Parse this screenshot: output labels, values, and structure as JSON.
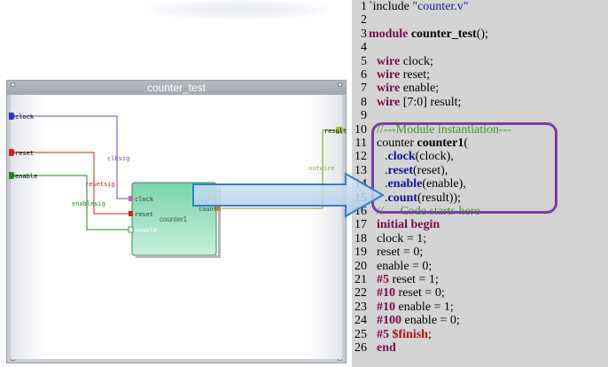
{
  "schematic": {
    "title": "counter_test",
    "ports": {
      "clock": "clock",
      "reset": "reset",
      "enable": "enable",
      "result": "result"
    },
    "wires": {
      "clksig": "clksig",
      "resetsig": "resetsig",
      "enablesig": "enablesig",
      "outwire": "outwire"
    },
    "instance": {
      "name": "counter1",
      "clock": "clock",
      "reset": "reset",
      "enable": "enable",
      "count": "count"
    }
  },
  "colors": {
    "highlight_box": "#7a3fa6",
    "arrow": "#2f7fd0",
    "clock_wire": "#7040c0",
    "reset_wire": "#d02020",
    "enable_wire": "#1a8a1a",
    "result_wire": "#a0c040"
  },
  "code": {
    "lines": [
      {
        "n": "1",
        "t": "`include \"counter.v\""
      },
      {
        "n": "2",
        "t": ""
      },
      {
        "n": "3",
        "t": "module counter_test();"
      },
      {
        "n": "4",
        "t": ""
      },
      {
        "n": "5",
        "t": "wire clock;"
      },
      {
        "n": "6",
        "t": "wire reset;"
      },
      {
        "n": "7",
        "t": "wire enable;"
      },
      {
        "n": "8",
        "t": "wire [7:0] result;"
      },
      {
        "n": "9",
        "t": ""
      },
      {
        "n": "10",
        "t": "//---Module instantiation---"
      },
      {
        "n": "11",
        "t": "counter counter1("
      },
      {
        "n": "12",
        "t": ".clock(clock),"
      },
      {
        "n": "13",
        "t": ".reset(reset),"
      },
      {
        "n": "14",
        "t": ".enable(enable),"
      },
      {
        "n": "15",
        "t": ".count(result));"
      },
      {
        "n": "16",
        "t": "//----Code starts here-----"
      },
      {
        "n": "17",
        "t": "initial begin"
      },
      {
        "n": "18",
        "t": "clock = 1;"
      },
      {
        "n": "19",
        "t": "reset = 0;"
      },
      {
        "n": "20",
        "t": "enable = 0;"
      },
      {
        "n": "21",
        "t": "#5 reset = 1;"
      },
      {
        "n": "22",
        "t": "#10 reset = 0;"
      },
      {
        "n": "23",
        "t": "#10 enable = 1;"
      },
      {
        "n": "24",
        "t": "#100 enable = 0;"
      },
      {
        "n": "25",
        "t": "#5 $finish;"
      },
      {
        "n": "26",
        "t": "end"
      }
    ]
  }
}
